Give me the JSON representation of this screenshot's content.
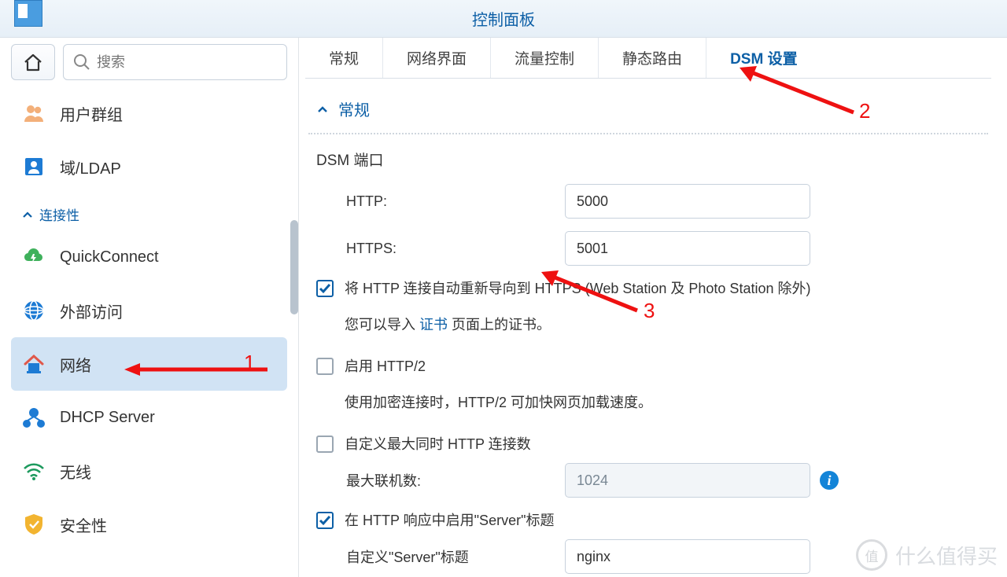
{
  "title": "控制面板",
  "search": {
    "placeholder": "搜索"
  },
  "sidebar": {
    "items": [
      {
        "label": "用户群组"
      },
      {
        "label": "域/LDAP"
      }
    ],
    "group_label": "连接性",
    "conn_items": [
      {
        "label": "QuickConnect"
      },
      {
        "label": "外部访问"
      },
      {
        "label": "网络"
      },
      {
        "label": "DHCP Server"
      },
      {
        "label": "无线"
      },
      {
        "label": "安全性"
      }
    ]
  },
  "tabs": [
    {
      "label": "常规"
    },
    {
      "label": "网络界面"
    },
    {
      "label": "流量控制"
    },
    {
      "label": "静态路由"
    },
    {
      "label": "DSM 设置"
    }
  ],
  "section_title": "常规",
  "form": {
    "dsm_port_label": "DSM 端口",
    "http_label": "HTTP:",
    "http_value": "5000",
    "https_label": "HTTPS:",
    "https_value": "5001",
    "redirect_label": "将 HTTP 连接自动重新导向到 HTTPS (Web Station 及 Photo Station 除外)",
    "cert_text_1": "您可以导入 ",
    "cert_link": "证书",
    "cert_text_2": " 页面上的证书。",
    "http2_label": "启用 HTTP/2",
    "http2_help": "使用加密连接时，HTTP/2 可加快网页加载速度。",
    "maxconn_label": "自定义最大同时 HTTP 连接数",
    "maxconn_field": "最大联机数:",
    "maxconn_value": "1024",
    "server_header_label": "在 HTTP 响应中启用\"Server\"标题",
    "server_custom_label": "自定义\"Server\"标题",
    "server_value": "nginx"
  },
  "annotations": {
    "n1": "1",
    "n2": "2",
    "n3": "3"
  },
  "watermark": {
    "badge": "值",
    "text": "什么值得买"
  }
}
